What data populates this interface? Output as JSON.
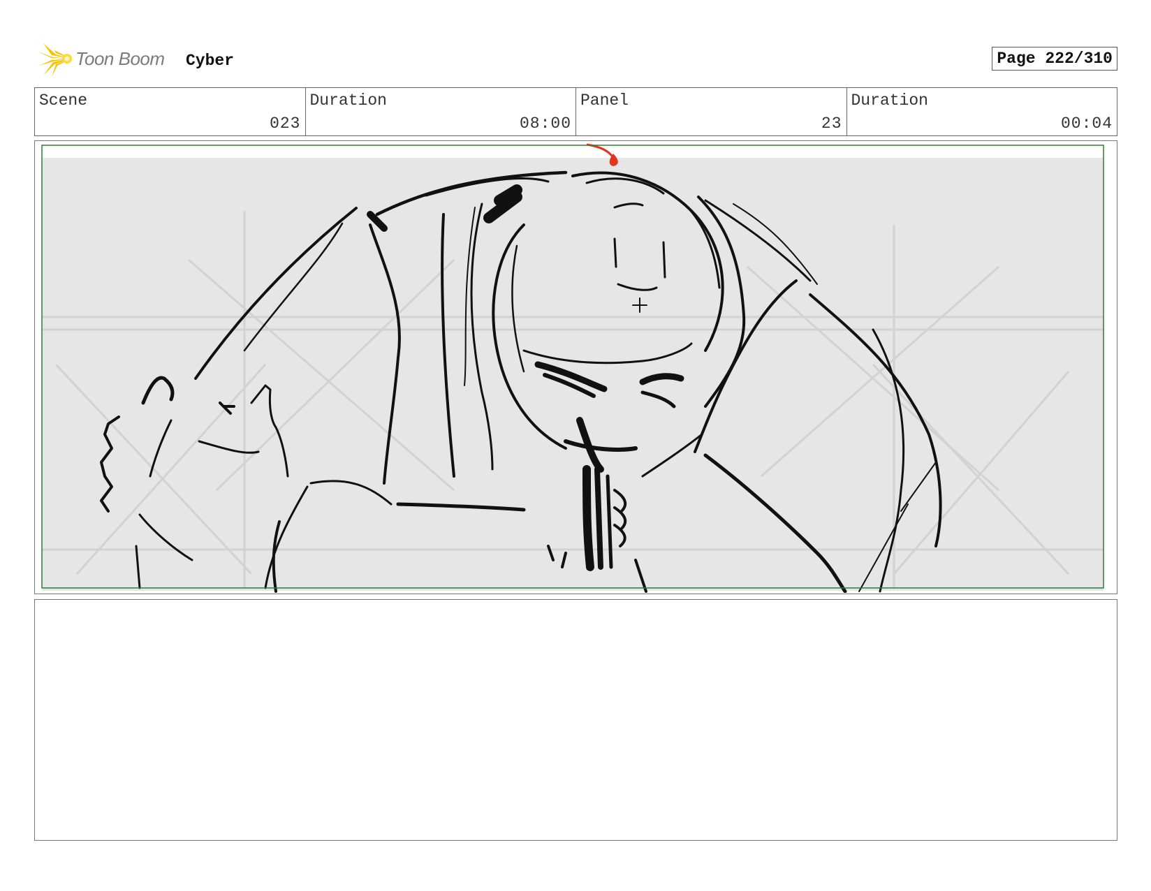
{
  "header": {
    "logo_text": "Toon Boom",
    "project_title": "Cyber",
    "page_label": "Page 222/310"
  },
  "info": [
    {
      "label": "Scene",
      "value": "023"
    },
    {
      "label": "Duration",
      "value": "08:00"
    },
    {
      "label": "Panel",
      "value": "23"
    },
    {
      "label": "Duration",
      "value": "00:04"
    }
  ],
  "panel": {
    "safe_frame_color": "#2e7d32",
    "background_color": "#e6e6e6",
    "marker_color": "#e5341b"
  },
  "notes": {
    "text": ""
  }
}
